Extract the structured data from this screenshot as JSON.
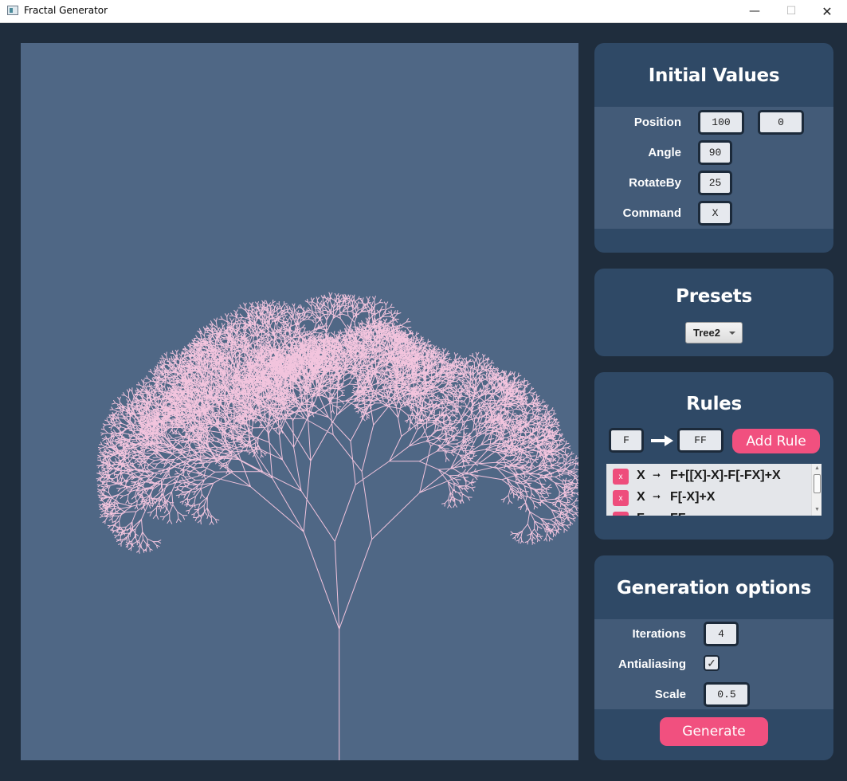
{
  "window": {
    "title": "Fractal Generator",
    "minimize_glyph": "—",
    "maximize_glyph": "☐",
    "close_glyph": "✕"
  },
  "initial_values": {
    "title": "Initial Values",
    "position_label": "Position",
    "position_x": "100",
    "position_y": "0",
    "angle_label": "Angle",
    "angle": "90",
    "rotateby_label": "RotateBy",
    "rotateby": "25",
    "command_label": "Command",
    "command": "X"
  },
  "presets": {
    "title": "Presets",
    "selected": "Tree2"
  },
  "rules": {
    "title": "Rules",
    "new_lhs": "F",
    "new_rhs": "FF",
    "add_label": "Add Rule",
    "delete_glyph": "x",
    "arrow_glyph": "➞",
    "items": [
      {
        "lhs": "X",
        "rhs": "F+[[X]-X]-F[-FX]+X"
      },
      {
        "lhs": "X",
        "rhs": "F[-X]+X"
      },
      {
        "lhs": "F",
        "rhs": "FF"
      }
    ]
  },
  "generation": {
    "title": "Generation options",
    "iterations_label": "Iterations",
    "iterations": "4",
    "antialiasing_label": "Antialiasing",
    "antialiasing": true,
    "check_glyph": "✓",
    "scale_label": "Scale",
    "scale": "0.5",
    "generate_label": "Generate"
  },
  "colors": {
    "background": "#1f2d3d",
    "canvas": "#4f6785",
    "panel": "#2f4966",
    "panel_band": "#435b78",
    "accent": "#f1507f",
    "fractal_line": "#f2c4dd"
  },
  "icons": {
    "app": "app-window-icon",
    "arrow": "right-arrow-icon",
    "dropdown": "dropdown-caret-icon",
    "scroll_up": "scroll-up-icon",
    "scroll_down": "scroll-down-icon"
  }
}
